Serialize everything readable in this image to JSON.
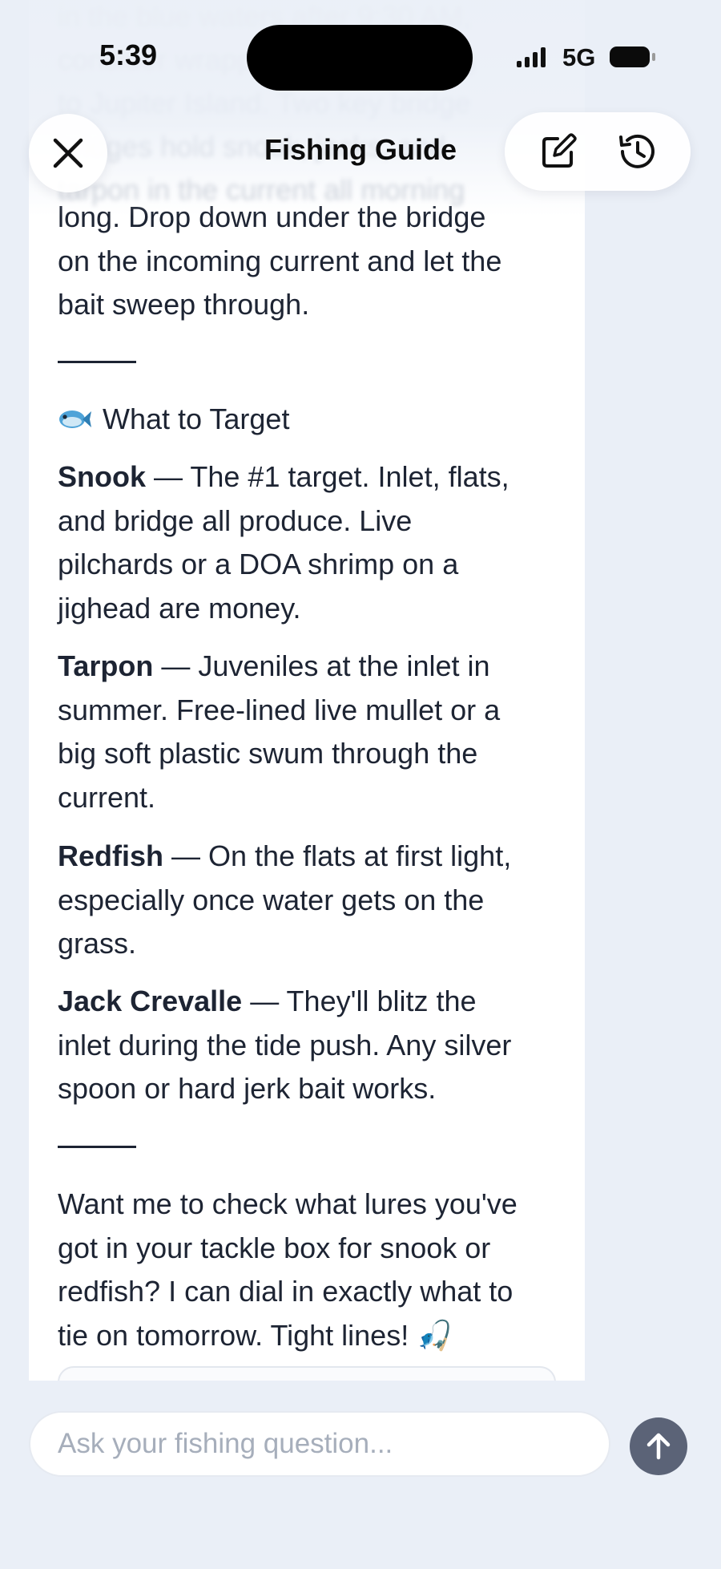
{
  "status_bar": {
    "time": "5:39",
    "network": "5G"
  },
  "header": {
    "title": "Fishing Guide",
    "close_icon": "close-icon",
    "new_chat_icon": "compose-icon",
    "history_icon": "history-icon"
  },
  "message": {
    "faded_lines": [
      "in the blue waters after 9:30 AM,",
      "consider wrapping up or heading",
      "to Jupiter Island. Two key bridge",
      "bridges hold snook, jacks, and",
      "tarpon in the current all morning"
    ],
    "intro_lines": [
      "long. Drop down under the bridge",
      "on the incoming current and let the",
      "bait sweep through."
    ],
    "section_heading": "What to Target",
    "section_icon": "fish-emoji",
    "targets": [
      {
        "name": "Snook",
        "lines": [
          "— The #1 target. Inlet, flats,",
          "and bridge all produce. Live",
          "pilchards or a DOA shrimp on a",
          "jighead are money."
        ]
      },
      {
        "name": "Tarpon",
        "lines": [
          "— Juveniles at the inlet in",
          "summer. Free-lined live mullet or a",
          "big soft plastic swum through the",
          "current."
        ]
      },
      {
        "name": "Redfish",
        "lines": [
          "— On the flats at first light,",
          "especially once water gets on the",
          "grass."
        ]
      },
      {
        "name": "Jack Crevalle",
        "lines": [
          "— They'll blitz the",
          "inlet during the tide push. Any silver",
          "spoon or hard jerk bait works."
        ]
      }
    ],
    "closing_lines": [
      "Want me to check what lures you've",
      "got in your tackle box for snook or",
      "redfish? I can dial in exactly what to",
      "tie on tomorrow. Tight lines! 🎣"
    ]
  },
  "composer": {
    "placeholder": "Ask your fishing question...",
    "value": "",
    "send_icon": "arrow-up-icon"
  },
  "colors": {
    "background": "#eaeff7",
    "text": "#1d2433",
    "send_button": "#5b6377",
    "placeholder": "#a6aebb"
  }
}
